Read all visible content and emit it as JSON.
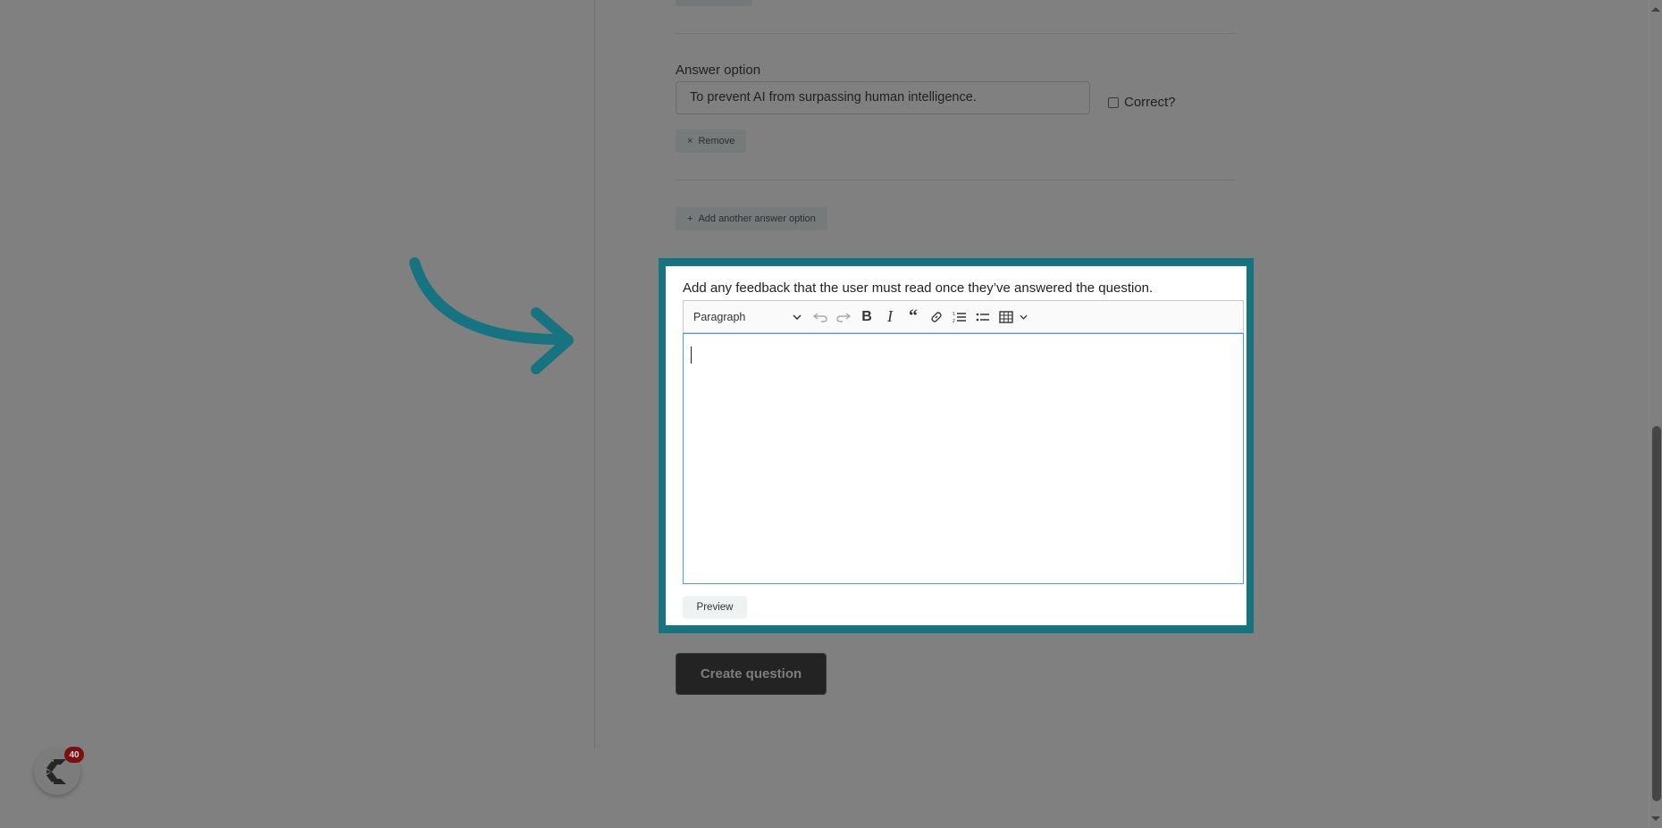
{
  "form": {
    "answer_label": "Answer option",
    "answer_value": "To prevent AI from surpassing human intelligence.",
    "correct_label": "Correct?",
    "correct_checked": false,
    "remove_label": "Remove",
    "remove_icon": "×",
    "add_option_label": "Add another answer option",
    "add_option_icon": "+"
  },
  "feedback": {
    "label": "Add any feedback that the user must read once they’ve answered the question.",
    "toolbar": {
      "block_format": "Paragraph",
      "icons": [
        "chevron-down-icon",
        "undo-icon",
        "redo-icon",
        "bold-icon",
        "italic-icon",
        "blockquote-icon",
        "link-icon",
        "numbered-list-icon",
        "bulleted-list-icon",
        "table-icon",
        "chevron-down-icon"
      ]
    },
    "content": "",
    "preview_label": "Preview"
  },
  "actions": {
    "create_label": "Create question"
  },
  "launcher": {
    "badge_count": "40"
  },
  "colors": {
    "highlight": "#167480",
    "overlay": "#808080",
    "focus_border": "#4a9fe4"
  }
}
